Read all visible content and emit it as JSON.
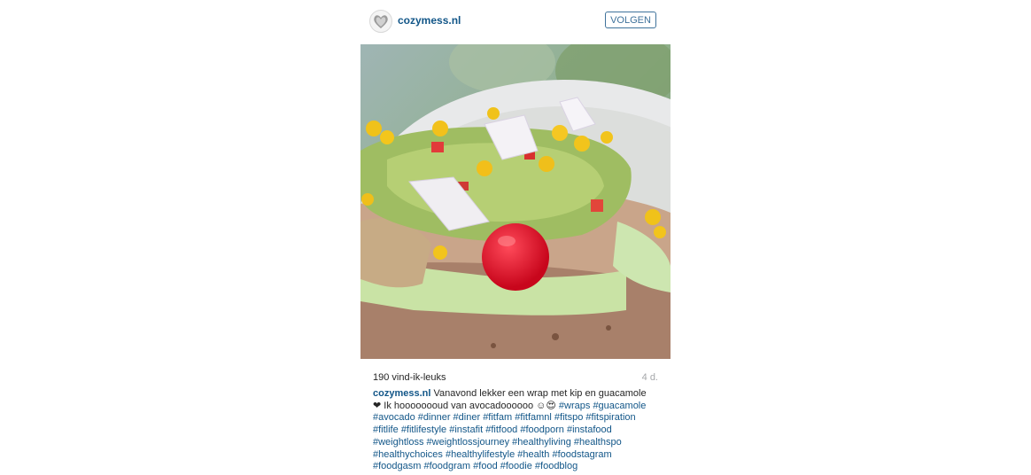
{
  "post": {
    "username": "cozymess.nl",
    "follow_label": "VOLGEN",
    "likes": "190 vind-ik-leuks",
    "age": "4 d.",
    "caption": {
      "username": "cozymess.nl",
      "text_line1": " Vanavond lekker een wrap met kip en guacamole",
      "heart": "❤",
      "text_line2": " Ik hoooooooud van avocadoooooo ☺😍 ",
      "hashtags": [
        "#wraps",
        "#guacamole",
        "#avocado",
        "#dinner",
        "#diner",
        "#fitfam",
        "#fitfamnl",
        "#fitspo",
        "#fitspiration",
        "#fitlife",
        "#fitlifestyle",
        "#instafit",
        "#fitfood",
        "#foodporn",
        "#instafood",
        "#weightloss",
        "#weightlossjourney",
        "#healthyliving",
        "#healthspo",
        "#healthychoices",
        "#healthylifestyle",
        "#health",
        "#foodstagram",
        "#foodgasm",
        "#foodgram",
        "#food",
        "#foodie",
        "#foodblog"
      ]
    }
  }
}
